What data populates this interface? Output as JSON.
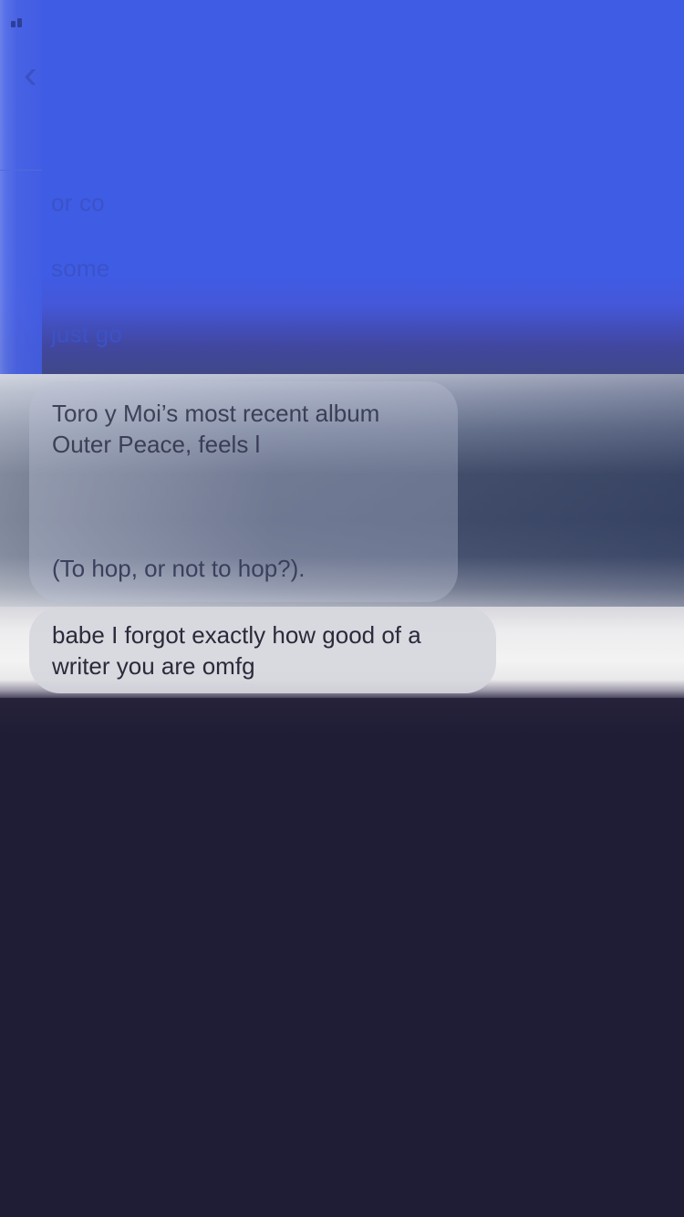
{
  "status_bar": {
    "signal_icon": "signal-bars-icon"
  },
  "nav": {
    "back_icon": "chevron-left-icon",
    "back_glyph": "‹"
  },
  "blurred_lines": [
    "or co",
    "some",
    "just go"
  ],
  "messages": [
    {
      "lines": [
        "Toro y Moi’s most recent album",
        "Outer Peace, feels l",
        "",
        "",
        "",
        "(To hop, or not to hop?)."
      ]
    },
    {
      "text": "babe I forgot exactly how good of a\nwriter you are omfg"
    }
  ],
  "colors": {
    "top_blue": "#3f5ce5",
    "bottom_dark": "#1f1c36",
    "bubble_text": "#2a2a3a"
  }
}
